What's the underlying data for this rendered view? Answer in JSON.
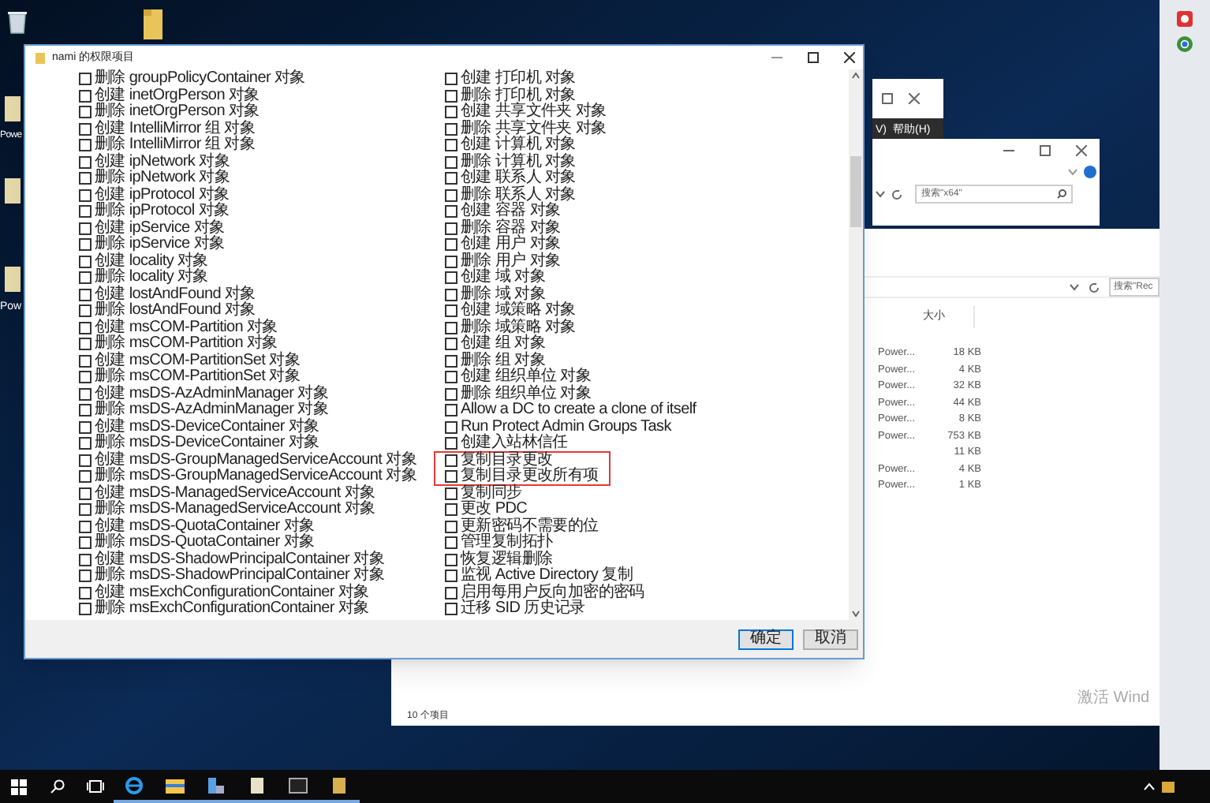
{
  "desktop": {
    "icon_labels": [
      "Powe",
      "Pow"
    ]
  },
  "explorer_window_1": {
    "menu_items": [
      "V)",
      "帮助(H)"
    ]
  },
  "explorer_window_2": {
    "search": {
      "placeholder": "搜索\"x64\""
    }
  },
  "explorer_window_3": {
    "search": {
      "placeholder": "搜索\"Rec"
    },
    "column": "大小",
    "rows": [
      {
        "type": "Power...",
        "size": "18 KB"
      },
      {
        "type": "Power...",
        "size": "4 KB"
      },
      {
        "type": "Power...",
        "size": "32 KB"
      },
      {
        "type": "Power...",
        "size": "44 KB"
      },
      {
        "type": "Power...",
        "size": "8 KB"
      },
      {
        "type": "Power...",
        "size": "753 KB"
      },
      {
        "type": "",
        "size": "11 KB"
      },
      {
        "type": "Power...",
        "size": "4 KB"
      },
      {
        "type": "Power...",
        "size": "1 KB"
      }
    ],
    "status": "10 个项目"
  },
  "activation_notice": "激活 Wind",
  "dialog": {
    "title": "nami 的权限项目",
    "left_column": [
      {
        "text": "删除 groupPolicyContainer 对象",
        "checked": false
      },
      {
        "text": "创建 inetOrgPerson 对象",
        "checked": false
      },
      {
        "text": "删除 inetOrgPerson 对象",
        "checked": false
      },
      {
        "text": "创建 IntelliMirror 组 对象",
        "checked": false
      },
      {
        "text": "删除 IntelliMirror 组 对象",
        "checked": false
      },
      {
        "text": "创建 ipNetwork 对象",
        "checked": false
      },
      {
        "text": "删除 ipNetwork 对象",
        "checked": false
      },
      {
        "text": "创建 ipProtocol 对象",
        "checked": false
      },
      {
        "text": "删除 ipProtocol 对象",
        "checked": false
      },
      {
        "text": "创建 ipService 对象",
        "checked": false
      },
      {
        "text": "删除 ipService 对象",
        "checked": false
      },
      {
        "text": "创建 locality 对象",
        "checked": false
      },
      {
        "text": "删除 locality 对象",
        "checked": false
      },
      {
        "text": "创建 lostAndFound 对象",
        "checked": false
      },
      {
        "text": "删除 lostAndFound 对象",
        "checked": false
      },
      {
        "text": "创建 msCOM-Partition 对象",
        "checked": false
      },
      {
        "text": "删除 msCOM-Partition 对象",
        "checked": false
      },
      {
        "text": "创建 msCOM-PartitionSet 对象",
        "checked": false
      },
      {
        "text": "删除 msCOM-PartitionSet 对象",
        "checked": false
      },
      {
        "text": "创建 msDS-AzAdminManager 对象",
        "checked": false
      },
      {
        "text": "删除 msDS-AzAdminManager 对象",
        "checked": false
      },
      {
        "text": "创建 msDS-DeviceContainer 对象",
        "checked": false
      },
      {
        "text": "删除 msDS-DeviceContainer 对象",
        "checked": false
      },
      {
        "text": "创建 msDS-GroupManagedServiceAccount 对象",
        "checked": false
      },
      {
        "text": "删除 msDS-GroupManagedServiceAccount 对象",
        "checked": false
      },
      {
        "text": "创建 msDS-ManagedServiceAccount 对象",
        "checked": false
      },
      {
        "text": "删除 msDS-ManagedServiceAccount 对象",
        "checked": false
      },
      {
        "text": "创建 msDS-QuotaContainer 对象",
        "checked": false
      },
      {
        "text": "删除 msDS-QuotaContainer 对象",
        "checked": false
      },
      {
        "text": "创建 msDS-ShadowPrincipalContainer 对象",
        "checked": false
      },
      {
        "text": "删除 msDS-ShadowPrincipalContainer 对象",
        "checked": false
      },
      {
        "text": "创建 msExchConfigurationContainer 对象",
        "checked": false
      },
      {
        "text": "删除 msExchConfigurationContainer 对象",
        "checked": false
      }
    ],
    "right_column": [
      {
        "text": "创建 打印机 对象",
        "checked": false,
        "highlighted": false
      },
      {
        "text": "删除 打印机 对象",
        "checked": false,
        "highlighted": false
      },
      {
        "text": "创建 共享文件夹 对象",
        "checked": false,
        "highlighted": false
      },
      {
        "text": "删除 共享文件夹 对象",
        "checked": false,
        "highlighted": false
      },
      {
        "text": "创建 计算机 对象",
        "checked": false,
        "highlighted": false
      },
      {
        "text": "删除 计算机 对象",
        "checked": false,
        "highlighted": false
      },
      {
        "text": "创建 联系人 对象",
        "checked": false,
        "highlighted": false
      },
      {
        "text": "删除 联系人 对象",
        "checked": false,
        "highlighted": false
      },
      {
        "text": "创建 容器 对象",
        "checked": false,
        "highlighted": false
      },
      {
        "text": "删除 容器 对象",
        "checked": false,
        "highlighted": false
      },
      {
        "text": "创建 用户 对象",
        "checked": false,
        "highlighted": false
      },
      {
        "text": "删除 用户 对象",
        "checked": false,
        "highlighted": false
      },
      {
        "text": "创建 域 对象",
        "checked": false,
        "highlighted": false
      },
      {
        "text": "删除 域 对象",
        "checked": false,
        "highlighted": false
      },
      {
        "text": "创建 域策略 对象",
        "checked": false,
        "highlighted": false
      },
      {
        "text": "删除 域策略 对象",
        "checked": false,
        "highlighted": false
      },
      {
        "text": "创建 组 对象",
        "checked": false,
        "highlighted": false
      },
      {
        "text": "删除 组 对象",
        "checked": false,
        "highlighted": false
      },
      {
        "text": "创建 组织单位 对象",
        "checked": false,
        "highlighted": false
      },
      {
        "text": "删除 组织单位 对象",
        "checked": false,
        "highlighted": false
      },
      {
        "text": "Allow a DC to create a clone of itself",
        "checked": false,
        "highlighted": false
      },
      {
        "text": "Run Protect Admin Groups Task",
        "checked": false,
        "highlighted": false
      },
      {
        "text": "创建入站林信任",
        "checked": false,
        "highlighted": false
      },
      {
        "text": "复制目录更改",
        "checked": false,
        "highlighted": true
      },
      {
        "text": "复制目录更改所有项",
        "checked": false,
        "highlighted": true
      },
      {
        "text": "复制同步",
        "checked": false,
        "highlighted": false
      },
      {
        "text": "更改 PDC",
        "checked": false,
        "highlighted": false
      },
      {
        "text": "更新密码不需要的位",
        "checked": false,
        "highlighted": false
      },
      {
        "text": "管理复制拓扑",
        "checked": false,
        "highlighted": false
      },
      {
        "text": "恢复逻辑删除",
        "checked": false,
        "highlighted": false
      },
      {
        "text": "监视 Active Directory 复制",
        "checked": false,
        "highlighted": false
      },
      {
        "text": "启用每用户反向加密的密码",
        "checked": false,
        "highlighted": false
      },
      {
        "text": "迁移 SID 历史记录",
        "checked": false,
        "highlighted": false
      }
    ],
    "buttons": [
      {
        "label": "确定",
        "default": true
      },
      {
        "label": "取消",
        "default": false
      }
    ]
  }
}
